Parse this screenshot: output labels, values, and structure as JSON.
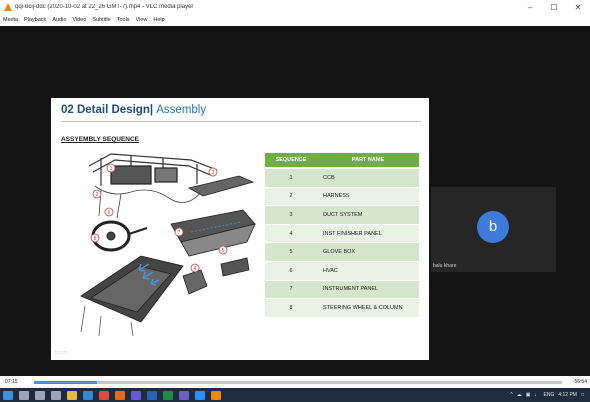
{
  "window": {
    "title": "qqi-bcij-ddc (2020-10-02 at 22_26 GMT-7).mp4 - VLC media player",
    "controls": [
      "–",
      "☐",
      "✕"
    ]
  },
  "menu": [
    "Media",
    "Playback",
    "Audio",
    "Video",
    "Subtitle",
    "Tools",
    "View",
    "Help"
  ],
  "slide": {
    "title_main": "02 Detail Design",
    "title_sep": "| ",
    "title_sub": "Assembly",
    "subtitle": "ASSYEMBLY SEQUENCE",
    "footer": "□ □ □",
    "diagram_callouts": [
      "1",
      "2",
      "3",
      "4",
      "5",
      "6",
      "7",
      "8"
    ],
    "table_header": {
      "sequence": "SEQUENCE",
      "part": "PART NAME"
    },
    "rows": [
      {
        "seq": "1",
        "part": "CCB"
      },
      {
        "seq": "2",
        "part": "HARNESS"
      },
      {
        "seq": "3",
        "part": "DUCT SYSTEM"
      },
      {
        "seq": "4",
        "part": "INST FINISHER PANEL"
      },
      {
        "seq": "5",
        "part": "GLOVE BOX"
      },
      {
        "seq": "6",
        "part": "HVAC"
      },
      {
        "seq": "7",
        "part": "INSTRUMENT PANEL"
      },
      {
        "seq": "8",
        "part": "STEERING WHEEL & COLUMN"
      }
    ]
  },
  "participant": {
    "initial": "b",
    "name": "balu khare",
    "avatar_color": "#3e7ad9"
  },
  "player": {
    "elapsed": "07:15",
    "remaining": "-56:54",
    "progress": 0.12
  },
  "taskbar": {
    "time": "4:12 PM",
    "tray_icons": [
      "^",
      "☁",
      "▣",
      "♩",
      "ENG"
    ],
    "apps": [
      {
        "name": "windows-start-icon",
        "color": "#3a8fe0"
      },
      {
        "name": "search-icon",
        "color": "#9aa6b8"
      },
      {
        "name": "cortana-icon",
        "color": "#9aa6b8"
      },
      {
        "name": "task-view-icon",
        "color": "#9aa6b8"
      },
      {
        "name": "file-explorer-icon",
        "color": "#e8b83a"
      },
      {
        "name": "edge-icon",
        "color": "#2e8ad8"
      },
      {
        "name": "chrome-icon",
        "color": "#e04a3a"
      },
      {
        "name": "firefox-icon",
        "color": "#e66a1a"
      },
      {
        "name": "store-icon",
        "color": "#6a5ad8"
      },
      {
        "name": "word-icon",
        "color": "#2b5fb8"
      },
      {
        "name": "excel-icon",
        "color": "#1f8a4a"
      },
      {
        "name": "teams-icon",
        "color": "#6b62c8"
      },
      {
        "name": "zoom-icon",
        "color": "#2d8cff"
      },
      {
        "name": "vlc-icon",
        "color": "#f08a00"
      }
    ]
  }
}
